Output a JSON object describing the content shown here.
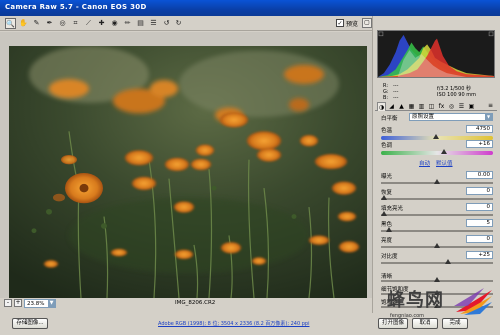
{
  "window": {
    "title": "Camera Raw 5.7  -  Canon EOS 30D",
    "minimize": "_",
    "maximize": "□",
    "close": "×"
  },
  "toolbar": {
    "preview_label": "预览"
  },
  "statusbar": {
    "zoom": "23.8%",
    "filename": "IMG_8206.CR2"
  },
  "panel": {
    "readout": {
      "r": "R:",
      "g": "G:",
      "b": "B:",
      "r_val": "---",
      "g_val": "---",
      "b_val": "---",
      "exif_line1": "f/3.2   1/500 秒",
      "exif_line2": "ISO 100   90 mm"
    },
    "section_title": "基本",
    "white_balance_label": "白平衡",
    "white_balance_value": "原照设置",
    "temperature_label": "色温",
    "temperature_value": "4750",
    "tint_label": "色调",
    "tint_value": "+16",
    "auto_link": "自动",
    "default_link": "默认值",
    "sliders": [
      {
        "label": "曝光",
        "value": "0.00",
        "pos": 0.5
      },
      {
        "label": "恢复",
        "value": "0",
        "pos": 0.0
      },
      {
        "label": "填充亮光",
        "value": "0",
        "pos": 0.0
      },
      {
        "label": "黑色",
        "value": "5",
        "pos": 0.05
      },
      {
        "label": "亮度",
        "value": "0",
        "pos": 0.5
      },
      {
        "label": "对比度",
        "value": "+25",
        "pos": 0.6
      }
    ],
    "lower_sliders": [
      {
        "label": "清晰",
        "pos": 0.5
      },
      {
        "label": "细节饱和度",
        "pos": 0.5
      },
      {
        "label": "饱和度",
        "pos": 0.5
      }
    ]
  },
  "bottombar": {
    "save_button": "存储图像...",
    "workflow_link": "Adobe RGB (1998); 8 位; 3504 x 2336 (8.2 百万像素); 240 ppi",
    "open_button": "打开图像",
    "cancel_button": "取消",
    "done_button": "完成"
  },
  "watermark": {
    "text": "蜂鸟网",
    "url": "fengniao.com"
  }
}
